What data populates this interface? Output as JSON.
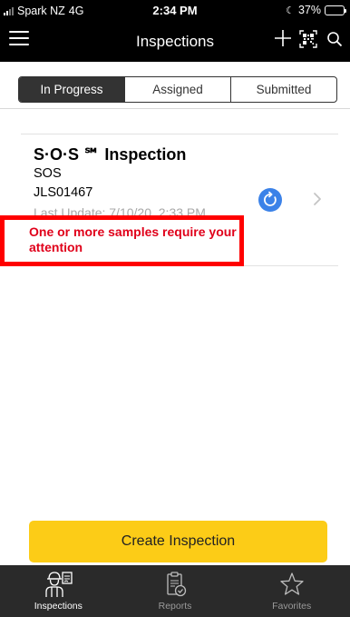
{
  "status_bar": {
    "carrier": "Spark NZ",
    "network": "4G",
    "time": "2:34 PM",
    "battery_percent": "37%",
    "battery_level": 0.37
  },
  "header": {
    "title": "Inspections",
    "icons": [
      "menu-icon",
      "plus-icon",
      "qr-code-icon",
      "search-icon"
    ]
  },
  "tabs": [
    {
      "label": "In Progress",
      "active": true
    },
    {
      "label": "Assigned",
      "active": false
    },
    {
      "label": "Submitted",
      "active": false
    }
  ],
  "inspection": {
    "title": "S·O·S ℠ Inspection",
    "type": "SOS",
    "id": "JLS01467",
    "last_update": "Last Update: 7/10/20, 2:33 PM",
    "alert": "One or more samples require your attention",
    "sync_icon": "sync-icon",
    "chevron_icon": "chevron-right-icon"
  },
  "create_button": {
    "label": "Create Inspection"
  },
  "bottom_nav": [
    {
      "label": "Inspections",
      "icon": "inspector-icon",
      "active": true
    },
    {
      "label": "Reports",
      "icon": "report-icon",
      "active": false
    },
    {
      "label": "Favorites",
      "icon": "star-icon",
      "active": false
    }
  ],
  "colors": {
    "header_bg": "#000000",
    "accent_yellow": "#fccc17",
    "alert_red": "#e0001a",
    "highlight_border": "#ff0000",
    "sync_blue": "#3b82e8",
    "nav_bg": "#2a2a2a"
  }
}
